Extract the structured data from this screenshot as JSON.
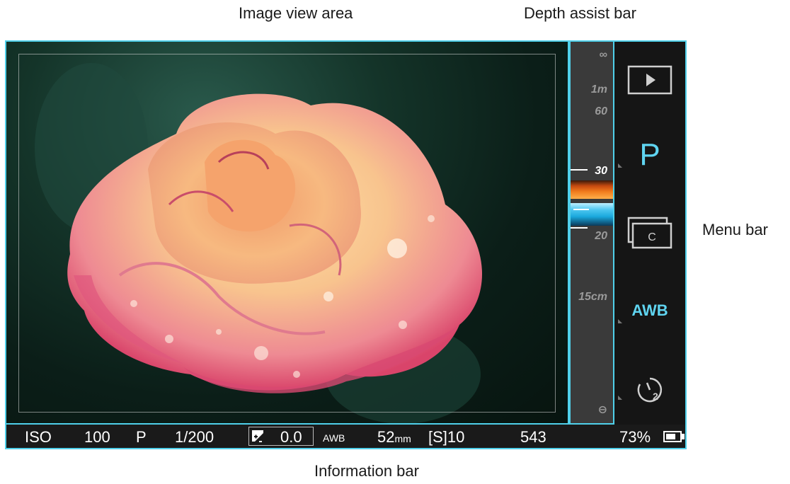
{
  "callouts": {
    "image_view_area": "Image view area",
    "depth_assist_bar": "Depth assist bar",
    "menu_bar": "Menu bar",
    "information_bar": "Information bar"
  },
  "depth_scale": {
    "infinity": "∞",
    "one_meter": "1m",
    "sixty": "60",
    "thirty": "30",
    "twenty": "20",
    "fifteen_cm": "15cm",
    "min_focus": "⊖"
  },
  "menu": {
    "mode": "P",
    "awb": "AWB"
  },
  "info": {
    "iso_label": "ISO",
    "iso_value": "100",
    "mode": "P",
    "shutter": "1/200",
    "ev": "0.0",
    "awb": "AWB",
    "focal_length": "52",
    "focal_unit": "mm",
    "drive": "[S]10",
    "shots_remaining": "543",
    "battery": "73%"
  },
  "battery_level": 0.73,
  "colors": {
    "accent": "#4fd0ea",
    "menu_text": "#5fd4f0",
    "warm_band": "#f07a1c",
    "cool_band": "#1aa8dc"
  },
  "icons": {
    "play": "play-icon",
    "continuous": "continuous-shooting-icon",
    "self_timer": "self-timer-icon",
    "ev": "exposure-compensation-icon",
    "battery": "battery-icon"
  }
}
